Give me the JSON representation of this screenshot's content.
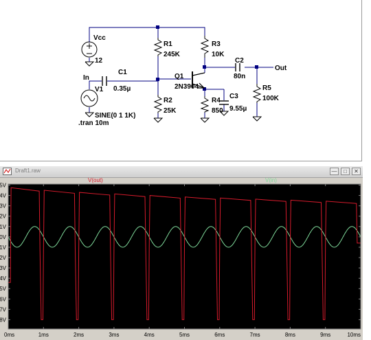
{
  "schematic": {
    "sources": {
      "vcc_name": "Vcc",
      "vcc_value": "12",
      "v1_name": "V1",
      "v1_value": "SINE(0 1 1K)",
      "tran": ".tran 10m"
    },
    "nets": {
      "in": "In",
      "out": "Out"
    },
    "parts": {
      "c1_name": "C1",
      "c1_value": "0.35µ",
      "r1_name": "R1",
      "r1_value": "245K",
      "r2_name": "R2",
      "r2_value": "25K",
      "r3_name": "R3",
      "r3_value": "10K",
      "q1_name": "Q1",
      "q1_value": "2N3904",
      "c2_name": "C2",
      "c2_value": "80n",
      "r4_name": "R4",
      "r4_value": "850",
      "c3_name": "C3",
      "c3_value": "9.55µ",
      "r5_name": "R5",
      "r5_value": "100K"
    }
  },
  "plot_window": {
    "title": "Draft1.raw",
    "buttons": {
      "minimize": "—",
      "maximize": "□",
      "close": "✕"
    }
  },
  "chart_data": {
    "type": "line",
    "x_unit": "ms",
    "xlim": [
      0,
      10
    ],
    "x_ticks": [
      "0ms",
      "1ms",
      "2ms",
      "3ms",
      "4ms",
      "5ms",
      "6ms",
      "7ms",
      "8ms",
      "9ms",
      "10ms"
    ],
    "y_ticks": [
      "5V",
      "4V",
      "3V",
      "2V",
      "1V",
      "0V",
      "-1V",
      "-2V",
      "-3V",
      "-4V",
      "-5V",
      "-6V",
      "-7V",
      "-8V"
    ],
    "ylim": [
      -8.9,
      5.1
    ],
    "grid": false,
    "background": "#000000",
    "series": [
      {
        "name": "V(out)",
        "color": "#d81b2c",
        "highs": [
          4.75,
          4.5,
          4.3,
          4.15,
          4.0,
          3.85,
          3.75,
          3.65,
          3.55,
          3.45
        ],
        "lows": [
          -1.3,
          -1.3,
          -1.1,
          -1.0,
          -0.9,
          -0.8,
          -0.75,
          -0.7,
          -0.65,
          -0.6
        ],
        "dip_min": -8.0,
        "start": -4.4
      },
      {
        "name": "V(in)",
        "color": "#7fd99a",
        "amplitude": 1.0,
        "frequency_khz": 1.0
      }
    ]
  }
}
